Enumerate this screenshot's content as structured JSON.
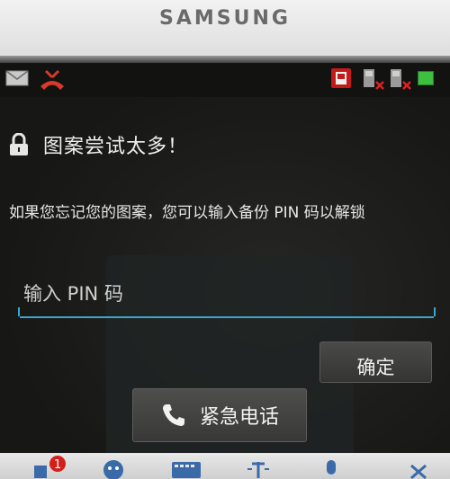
{
  "device": {
    "brand": "SAMSUNG"
  },
  "statusbar": {
    "icons": [
      "mail-icon",
      "missed-call-icon",
      "sim-alert-icon",
      "sim1-no-signal-icon",
      "sim2-no-signal-icon",
      "battery-icon"
    ],
    "battery_color": "#3fbf3f"
  },
  "lockscreen": {
    "title": "图案尝试太多！",
    "message": "如果您忘记您的图案，您可以输入备份 PIN 码以解锁",
    "pin": {
      "placeholder": "输入 PIN 码",
      "value": ""
    },
    "confirm_label": "确定",
    "emergency_label": "紧急电话"
  },
  "bottom_bar": {
    "icons": [
      "notification-badge-icon",
      "emoticon-icon",
      "keyboard-icon",
      "text-cursor-icon",
      "microphone-icon",
      "close-icon"
    ],
    "badge_count": "1"
  },
  "colors": {
    "accent": "#3aa7c9",
    "badge": "#d4201a"
  }
}
